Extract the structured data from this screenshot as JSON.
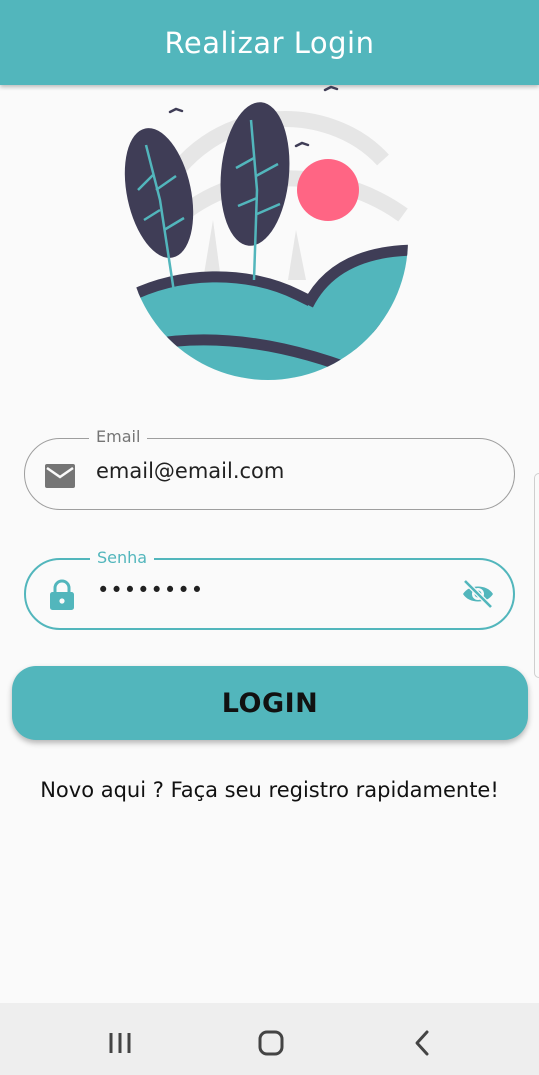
{
  "app_bar": {
    "title": "Realizar Login"
  },
  "form": {
    "email": {
      "label": "Email",
      "value": "email@email.com",
      "icon": "mail-icon"
    },
    "password": {
      "label": "Senha",
      "value": "••••••••",
      "icon": "lock-icon",
      "toggle_icon": "eye-off-icon"
    },
    "login_button": {
      "label": "LOGIN"
    },
    "register_link": {
      "text": "Novo aqui ? Faça seu registro rapidamente!"
    }
  },
  "nav_bar": {
    "icons": [
      "recent-apps-icon",
      "home-icon",
      "back-icon"
    ]
  },
  "colors": {
    "accent": "#52b6bc",
    "dark": "#3f3d56",
    "sun": "#ff6584",
    "background": "#fafafa"
  }
}
